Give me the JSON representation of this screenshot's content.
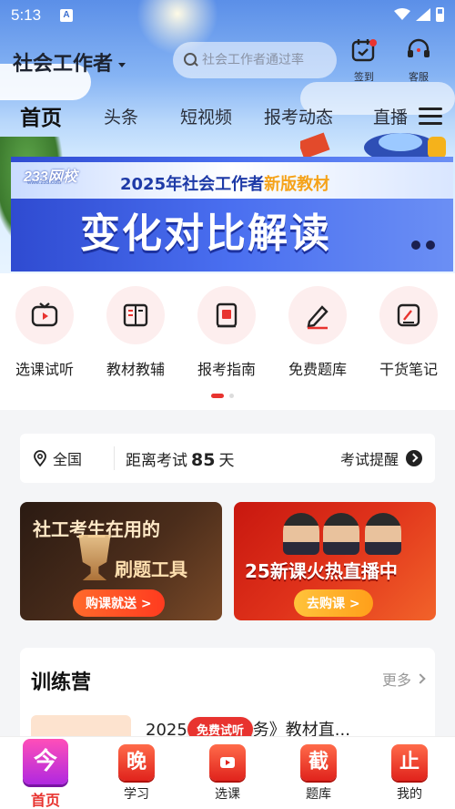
{
  "status_bar": {
    "time": "5:13",
    "notification_glyph": "A"
  },
  "header": {
    "city": "社会工作者",
    "search_placeholder": "社会工作者通过率",
    "checkin_label": "签到",
    "service_label": "客服"
  },
  "tabs": [
    {
      "label": "首页",
      "active": true
    },
    {
      "label": "头条",
      "active": false
    },
    {
      "label": "短视频",
      "active": false
    },
    {
      "label": "报考动态",
      "active": false
    },
    {
      "label": "直播",
      "active": false
    }
  ],
  "banner": {
    "brand": "233网校",
    "brand_url": "www.233.com",
    "subtitle_prefix": "2025年社会工作者",
    "subtitle_highlight": "新版教材",
    "title": "变化对比解读"
  },
  "quick_entries": [
    {
      "label": "选课试听",
      "icon": "tv-play-icon"
    },
    {
      "label": "教材教辅",
      "icon": "book-icon"
    },
    {
      "label": "报考指南",
      "icon": "guide-book-icon"
    },
    {
      "label": "免费题库",
      "icon": "pen-edit-icon"
    },
    {
      "label": "干货笔记",
      "icon": "notes-icon"
    }
  ],
  "countdown": {
    "region": "全国",
    "prefix": "距离考试",
    "days": "85",
    "suffix": "天",
    "remind": "考试提醒"
  },
  "promos": {
    "left": {
      "line1": "社工考生在用的",
      "line2": "刷题工具",
      "button": "购课就送 >"
    },
    "right": {
      "title": "25新课火热直播中",
      "button": "去购课 >"
    }
  },
  "camp": {
    "title": "训练营",
    "more": "更多",
    "course": "2025《中级实务》教材直..."
  },
  "free_badge": "免费试听",
  "bottom_nav": [
    {
      "label": "首页",
      "glyph": "今",
      "active": true
    },
    {
      "label": "学习",
      "glyph": "晚",
      "active": false
    },
    {
      "label": "选课",
      "glyph": "",
      "active": false
    },
    {
      "label": "题库",
      "glyph": "截",
      "active": false
    },
    {
      "label": "我的",
      "glyph": "止",
      "active": false
    }
  ],
  "colors": {
    "accent": "#e8332f",
    "banner_blue": "#2f4bd1",
    "highlight": "#f5a31b"
  }
}
